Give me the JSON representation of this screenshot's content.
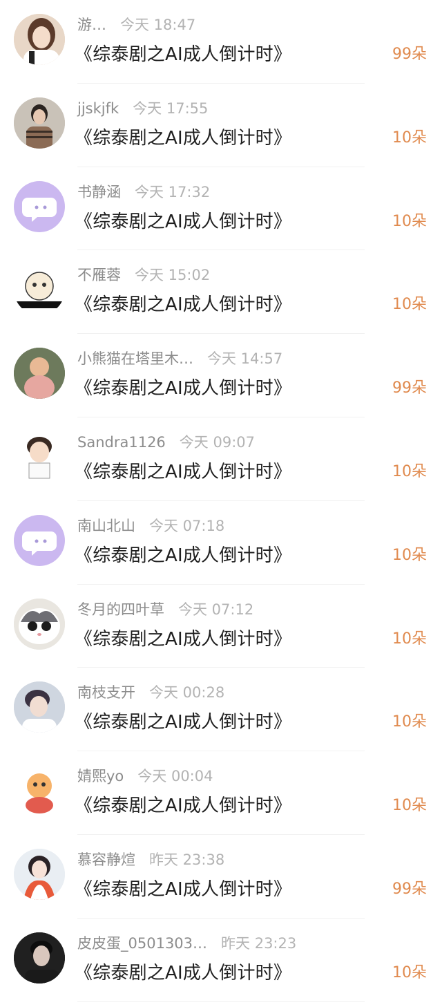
{
  "colors": {
    "accent_count": "#e08a4e",
    "title_text": "#1f1f1f",
    "meta_text": "#9a9a9a",
    "divider": "#f1f1f1",
    "default_avatar_bg": "#cbb8f0"
  },
  "rows": [
    {
      "username": "游…",
      "time": "今天 18:47",
      "title": "《综泰剧之AI成人倒计时》",
      "count": "99朵",
      "avatar": "photo-girl-avatar"
    },
    {
      "username": "jjskjfk",
      "time": "今天 17:55",
      "title": "《综泰剧之AI成人倒计时》",
      "count": "10朵",
      "avatar": "photo-person-avatar"
    },
    {
      "username": "书静涵",
      "time": "今天 17:32",
      "title": "《综泰剧之AI成人倒计时》",
      "count": "10朵",
      "avatar": "default-chat-avatar"
    },
    {
      "username": "不雁蓉",
      "time": "今天 15:02",
      "title": "《综泰剧之AI成人倒计时》",
      "count": "10朵",
      "avatar": "cartoon-sticker-avatar"
    },
    {
      "username": "小熊猫在塔里木…",
      "time": "今天 14:57",
      "title": "《综泰剧之AI成人倒计时》",
      "count": "99朵",
      "avatar": "photo-child-avatar"
    },
    {
      "username": "Sandra1126",
      "time": "今天 09:07",
      "title": "《综泰剧之AI成人倒计时》",
      "count": "10朵",
      "avatar": "cartoon-boy-avatar"
    },
    {
      "username": "南山北山",
      "time": "今天 07:18",
      "title": "《综泰剧之AI成人倒计时》",
      "count": "10朵",
      "avatar": "default-chat-avatar"
    },
    {
      "username": "冬月的四叶草",
      "time": "今天 07:12",
      "title": "《综泰剧之AI成人倒计时》",
      "count": "10朵",
      "avatar": "cat-avatar"
    },
    {
      "username": "南枝支开",
      "time": "今天 00:28",
      "title": "《综泰剧之AI成人倒计时》",
      "count": "10朵",
      "avatar": "photo-man-avatar"
    },
    {
      "username": "婧熙yo",
      "time": "今天 00:04",
      "title": "《综泰剧之AI成人倒计时》",
      "count": "10朵",
      "avatar": "dragon-cartoon-avatar"
    },
    {
      "username": "慕容静煊",
      "time": "昨天 23:38",
      "title": "《综泰剧之AI成人倒计时》",
      "count": "99朵",
      "avatar": "photo-girl-winter-avatar"
    },
    {
      "username": "皮皮蛋_0501303…",
      "time": "昨天 23:23",
      "title": "《综泰剧之AI成人倒计时》",
      "count": "10朵",
      "avatar": "photo-man-dark-avatar"
    }
  ]
}
